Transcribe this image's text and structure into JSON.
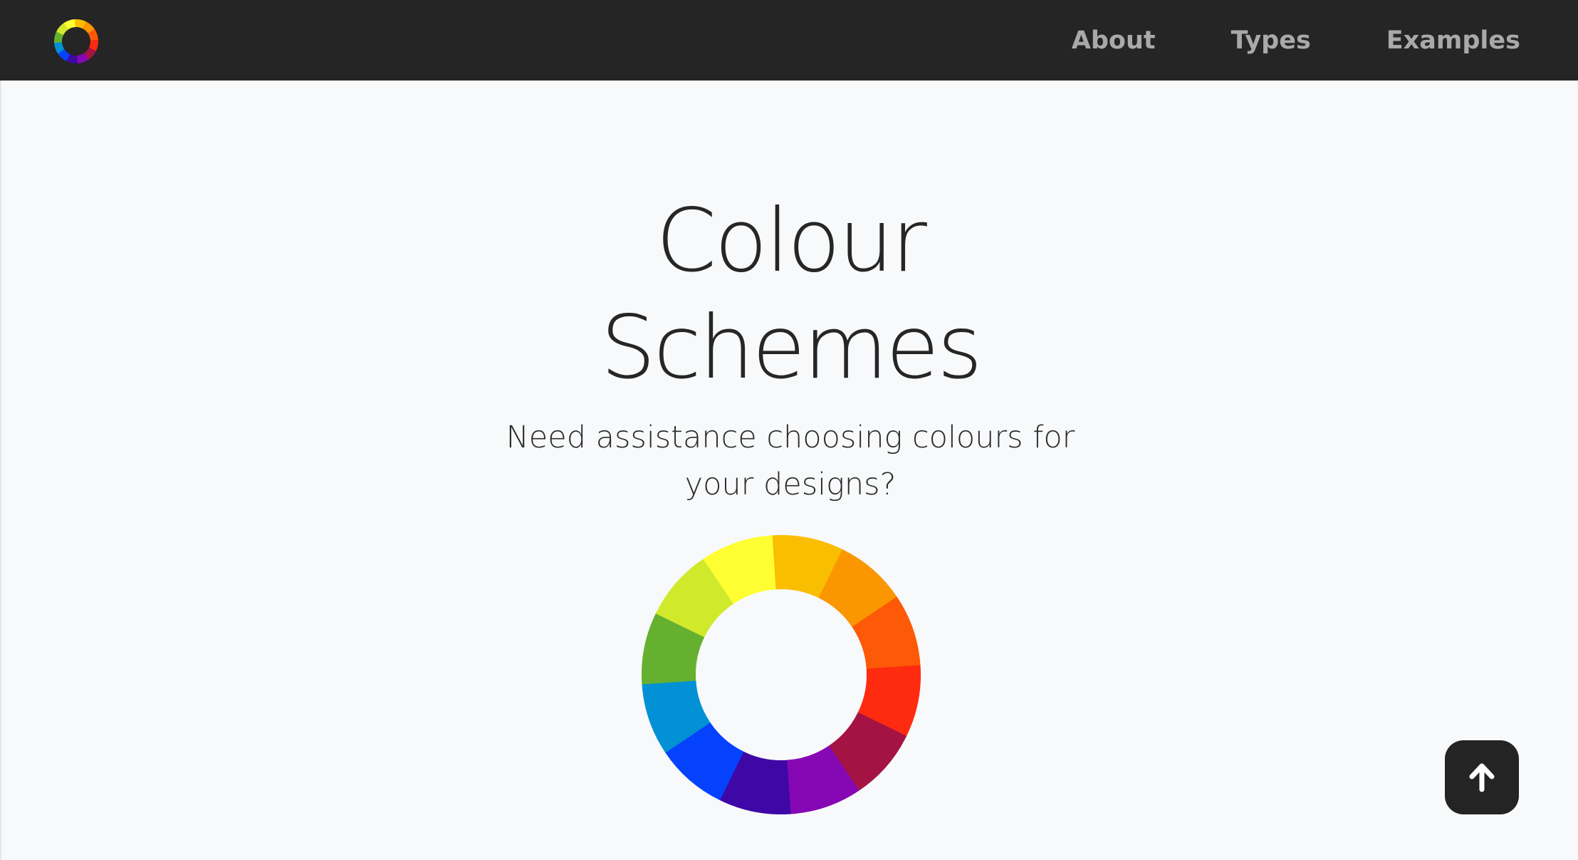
{
  "navbar": {
    "logo_icon": "colour-wheel-icon",
    "links": [
      "About",
      "Types",
      "Examples"
    ]
  },
  "hero": {
    "title_line1": "Colour",
    "title_line2": "Schemes",
    "subtitle_line1": "Need assistance choosing colours for",
    "subtitle_line2": "your designs?"
  },
  "colour_wheel": {
    "segments": [
      "#f9be00",
      "#fa9600",
      "#fd5906",
      "#fe2b10",
      "#a51345",
      "#8608b4",
      "#3f07a6",
      "#0542fd",
      "#0291d4",
      "#66b030",
      "#d0ea2b",
      "#fefe32"
    ]
  },
  "scroll_top_button": {
    "icon": "arrow-up-icon"
  }
}
